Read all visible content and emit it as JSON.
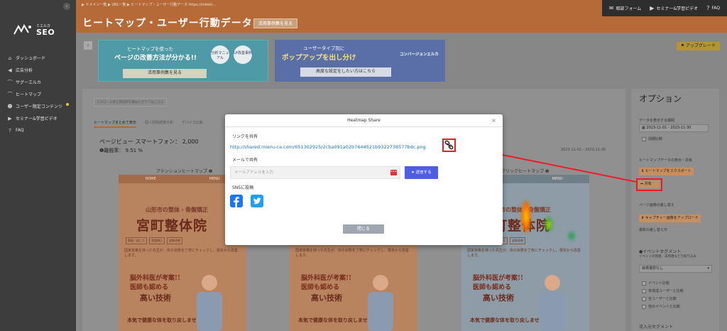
{
  "sidebar": {
    "logo_sub": "ミエルカ",
    "logo_main": "SEO",
    "items": [
      {
        "icon": "home-icon",
        "label": "ダッシュボード"
      },
      {
        "icon": "megaphone-icon",
        "label": "広告分析"
      },
      {
        "icon": "logo-small-icon",
        "label": "サグーエルカ"
      },
      {
        "icon": "logo-small-icon",
        "label": "ヒートマップ"
      },
      {
        "icon": "users-icon",
        "label": "ユーザー限定コンテンツ"
      },
      {
        "icon": "video-icon",
        "label": "セミナー&学習ビデオ"
      },
      {
        "icon": "question-icon",
        "label": "FAQ"
      }
    ]
  },
  "header": {
    "breadcrumb": "▶ ドメイン一覧 ▶ URL一覧 ▶ ヒートマップ・ユーザー行動データ https://miteki...",
    "title": "ヒートマップ・ユーザー行動データ",
    "cases_button": "活用事例集を見る",
    "top_links": {
      "contact": "相談フォーム",
      "seminar": "セミナー&学習ビデオ",
      "faq": "FAQ"
    }
  },
  "banners": {
    "b1_line1": "ヒートマップを使った",
    "b1_line2": "ページの改善方法が分かる!!",
    "b1_pill1": "分析マニュアル",
    "b1_pill2": "LP改善事例",
    "b1_cta": "活用事例集を見る",
    "b2_line1": "ユーザータイプ別に",
    "b2_line2": "ポップアップを出し分け",
    "b2_brand": "コンバージョンエルカ",
    "b2_cta": "高度な設定をしたい方はこちら"
  },
  "upgrade_button": "アップグレード",
  "panel": {
    "scroll_note": "スクロール率と熟読率を重ねたグラフはこちら",
    "tabs": [
      "ヒートマップまとめて表示",
      "個人別熟読率分析",
      "デバイス比較"
    ],
    "pageview_label": "ページビュー スマートフォン：",
    "pageview_value": "2,000",
    "exit_label": "❶離脱率：",
    "exit_value": "9.51 %",
    "date_range": "2023-11-01 - 2023-11-30",
    "attention_title": "アテンションヒートマップ ❶",
    "click_title": "クリックヒートマップ ❶",
    "site": {
      "nav_home": "HOME",
      "nav_menu": "MENU",
      "city": "山形市の整体・骨盤矯正",
      "clinic": "宮町整体院",
      "tags": [
        "腰痛・肩こり",
        "骨盤矯正",
        "姿勢改善"
      ],
      "lines": "国家資格を持った先生が、体の状態を丁寧にチェックし、根本から改善します。",
      "head1": "脳外科医が考案!!",
      "head2": "医師も認める",
      "head3": "高い技術",
      "foot": "本気で健康な体を取り戻しませんか？"
    }
  },
  "options": {
    "title": "オプション",
    "period_label": "データを表示する期間",
    "period_value": "2023-11-01 - 2023-11-30",
    "previous_compare": "前期比較",
    "export_label": "ヒートマップデータの表示・共有",
    "export_button": "ヒートマップをエクスポート",
    "share_button": "共有",
    "change_page_label": "ページ画像の差し替え",
    "upload_button": "キャプチャー画像をアップロード",
    "update_log": "最新の差し替え日",
    "event_label": "●イベントセグメント",
    "event_sub": "イベントの到達、未到達などで絞り込み",
    "event_select": "目標選択なし",
    "event_checks": [
      "イベント比較",
      "未達成ユーザーと比較",
      "全ユーザーと比較",
      "他のイベントと比較"
    ],
    "inflow_label": "流入元セグメント"
  },
  "modal": {
    "title": "Heatmap Share",
    "close_x": "×",
    "link_label": "リンクを共有",
    "share_url": "http://shared.mieru-ca.com/651302925/2cba091a02b7644521b9322738577bdc.png",
    "email_label": "メールで共有",
    "email_placeholder": "メールアドレスを入力",
    "send_button": "送信する",
    "sns_label": "SNSに投稿",
    "close_button": "閉じる"
  },
  "colors": {
    "header": "#b56a37",
    "sidebar": "#3d3d3d",
    "accent_link": "#1a73b8",
    "send_button": "#4e5de3",
    "highlight_red": "#ee1c24"
  }
}
